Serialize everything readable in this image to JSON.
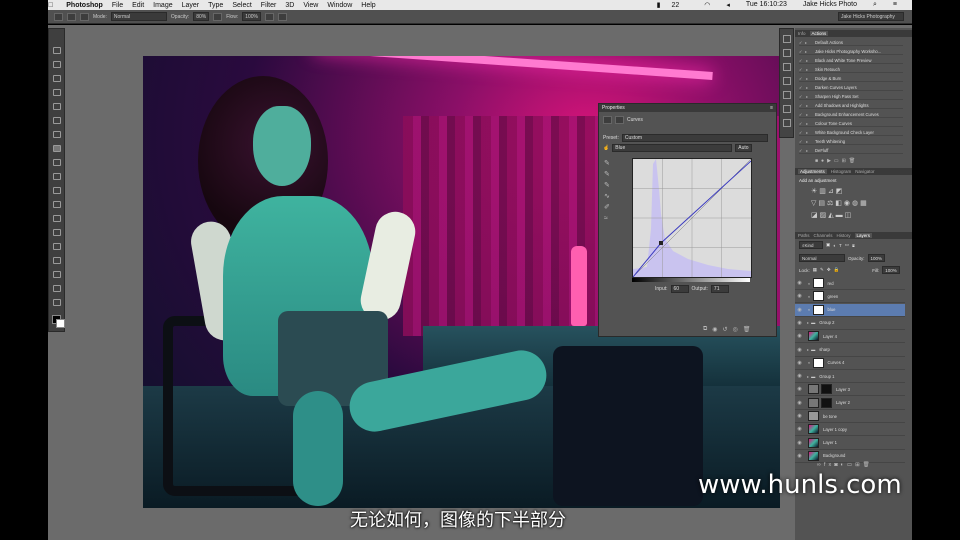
{
  "menubar": {
    "app": "Photoshop",
    "items": [
      "File",
      "Edit",
      "Image",
      "Layer",
      "Type",
      "Select",
      "Filter",
      "3D",
      "View",
      "Window",
      "Help"
    ],
    "battery": "22",
    "clock": "Tue 16:10:23",
    "user": "Jake Hicks Photo"
  },
  "options": {
    "mode_label": "Mode:",
    "mode_value": "Normal",
    "opacity_label": "Opacity:",
    "opacity_value": "80%",
    "flow_label": "Flow:",
    "flow_value": "100%",
    "workspace": "Jake Hicks Photography"
  },
  "properties": {
    "tab": "Properties",
    "type": "Curves",
    "preset_label": "Preset:",
    "preset_value": "Custom",
    "channel_value": "Blue",
    "auto_label": "Auto",
    "input_label": "Input:",
    "input_value": "60",
    "output_label": "Output:",
    "output_value": "71"
  },
  "actions_panel": {
    "tabs": [
      "Info",
      "Actions"
    ],
    "active": "Actions",
    "items": [
      "Default Actions",
      "Jake Hicks Photography Worksho...",
      "Black and White Tone Preview",
      "Skin Retouch",
      "Dodge & Burn",
      "Darken Curves Layers",
      "Sharpen High Pass Set",
      "Add Shadows and Highlights",
      "Background Enhancement Curves",
      "Colour Tone Curves",
      "White Background Check Layer",
      "Teeth Whitening",
      "DeFluff"
    ]
  },
  "adjust_panel": {
    "tabs": [
      "Adjustments",
      "Histogram",
      "Navigator"
    ],
    "active": "Adjustments",
    "heading": "Add an adjustment"
  },
  "layers_panel": {
    "tabs": [
      "Paths",
      "Channels",
      "History",
      "Layers"
    ],
    "active": "Layers",
    "kind_label": "Kind",
    "blend": "Normal",
    "opacity_label": "Opacity:",
    "opacity_value": "100%",
    "lock_label": "Lock:",
    "fill_label": "Fill:",
    "fill_value": "100%",
    "layers": [
      {
        "name": "red",
        "kind": "adj"
      },
      {
        "name": "green",
        "kind": "adj"
      },
      {
        "name": "blue",
        "kind": "adj",
        "selected": true
      },
      {
        "name": "Group 2",
        "kind": "group"
      },
      {
        "name": "Layer 4",
        "kind": "img"
      },
      {
        "name": "sharp",
        "kind": "group"
      },
      {
        "name": "Curves 4",
        "kind": "adj"
      },
      {
        "name": "Group 1",
        "kind": "group"
      },
      {
        "name": "Layer 3",
        "kind": "mask"
      },
      {
        "name": "Layer 2",
        "kind": "mask"
      },
      {
        "name": "be tone",
        "kind": "gray"
      },
      {
        "name": "Layer 1 copy",
        "kind": "img"
      },
      {
        "name": "Layer 1",
        "kind": "img"
      },
      {
        "name": "Background",
        "kind": "img"
      }
    ]
  },
  "overlay": {
    "subtitle": "无论如何，图像的下半部分",
    "watermark": "www.hunls.com"
  },
  "colors": {
    "panel": "#535353",
    "selection": "#5c7cb0",
    "curve_fill": "#c9c3ef",
    "curve_line": "#3c3cc0"
  }
}
